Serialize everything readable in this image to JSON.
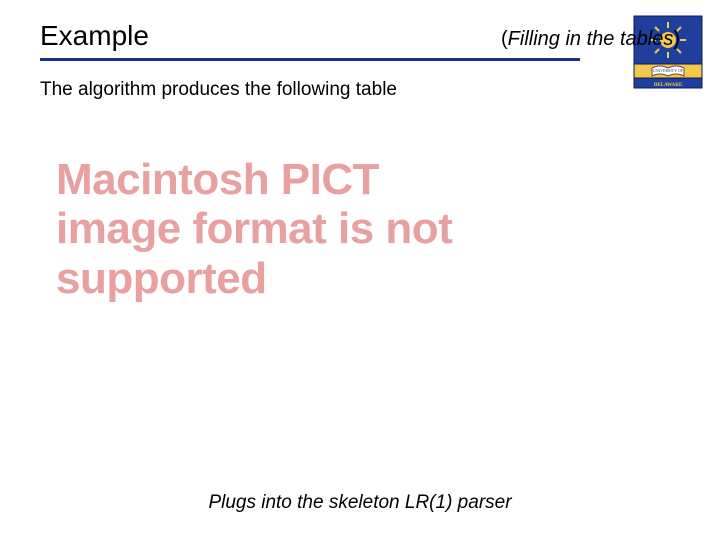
{
  "header": {
    "title": "Example",
    "subtitle_open": "(",
    "subtitle_inner": "Filling in the tables",
    "subtitle_close": ")"
  },
  "body": {
    "intro": "The algorithm produces the following table"
  },
  "placeholder": {
    "text": "Macintosh PICT image format is not supported"
  },
  "footer": {
    "text": "Plugs into the skeleton LR(1) parser"
  },
  "logo": {
    "alt": "University of Delaware crest",
    "colors": {
      "blue": "#1f3f9e",
      "gold": "#f2c94c",
      "brown": "#7a4a1f"
    }
  }
}
